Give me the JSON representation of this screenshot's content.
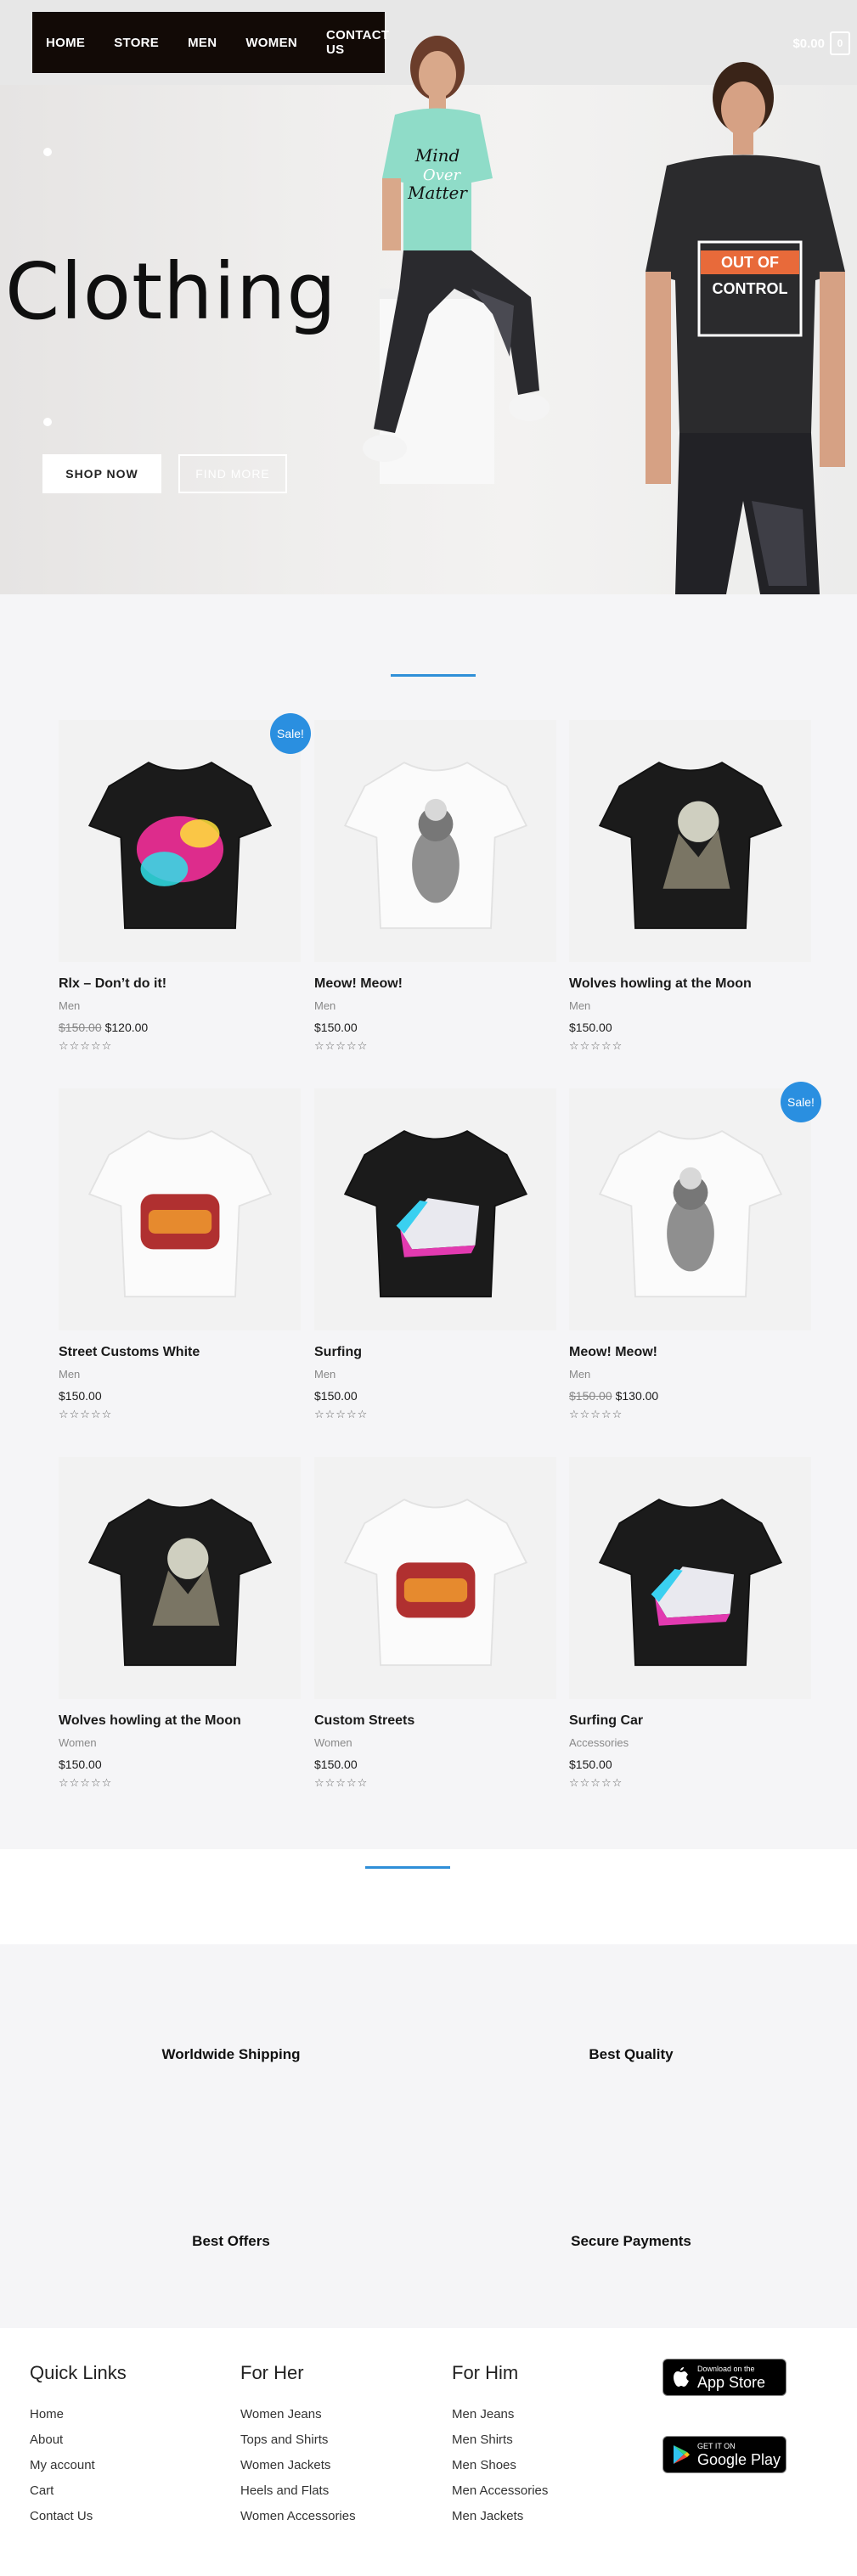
{
  "nav": {
    "items": [
      "HOME",
      "STORE",
      "MEN",
      "WOMEN",
      "CONTACT US"
    ],
    "cart_total": "$0.00",
    "cart_count": "0"
  },
  "hero": {
    "title": "Clothing",
    "shop_now": "SHOP NOW",
    "find_more": "FIND MORE",
    "shirt1_text": [
      "Mind",
      "Over",
      "Matter"
    ],
    "shirt2_text": [
      "OUT OF",
      "CONTROL"
    ]
  },
  "products": [
    {
      "name": "Rlx – Don’t do it!",
      "category": "Men",
      "old_price": "$150.00",
      "price": "$120.00",
      "sale": "Sale!",
      "shirt": "black",
      "art": "graffiti"
    },
    {
      "name": "Meow! Meow!",
      "category": "Men",
      "old_price": "",
      "price": "$150.00",
      "sale": "",
      "shirt": "white",
      "art": "cat"
    },
    {
      "name": "Wolves howling at the Moon",
      "category": "Men",
      "old_price": "",
      "price": "$150.00",
      "sale": "",
      "shirt": "black",
      "art": "wolves"
    },
    {
      "name": "Street Customs White",
      "category": "Men",
      "old_price": "",
      "price": "$150.00",
      "sale": "",
      "shirt": "white",
      "art": "street"
    },
    {
      "name": "Surfing",
      "category": "Men",
      "old_price": "",
      "price": "$150.00",
      "sale": "",
      "shirt": "black",
      "art": "car"
    },
    {
      "name": "Meow! Meow!",
      "category": "Men",
      "old_price": "$150.00",
      "price": "$130.00",
      "sale": "Sale!",
      "shirt": "white",
      "art": "cat"
    },
    {
      "name": "Wolves howling at the Moon",
      "category": "Women",
      "old_price": "",
      "price": "$150.00",
      "sale": "",
      "shirt": "black",
      "art": "wolves"
    },
    {
      "name": "Custom Streets",
      "category": "Women",
      "old_price": "",
      "price": "$150.00",
      "sale": "",
      "shirt": "white",
      "art": "street"
    },
    {
      "name": "Surfing Car",
      "category": "Accessories",
      "old_price": "",
      "price": "$150.00",
      "sale": "",
      "shirt": "black",
      "art": "car"
    }
  ],
  "rating_stars": "☆☆☆☆☆",
  "features": [
    "Worldwide Shipping",
    "Best Quality",
    "Best Offers",
    "Secure Payments"
  ],
  "footer": {
    "cols": [
      {
        "title": "Quick Links",
        "links": [
          "Home",
          "About",
          "My account",
          "Cart",
          "Contact Us"
        ]
      },
      {
        "title": "For Her",
        "links": [
          "Women Jeans",
          "Tops and Shirts",
          "Women Jackets",
          "Heels and Flats",
          "Women Accessories"
        ]
      },
      {
        "title": "For Him",
        "links": [
          "Men Jeans",
          "Men Shirts",
          "Men Shoes",
          "Men Accessories",
          "Men Jackets"
        ]
      }
    ],
    "app_store": {
      "small": "Download on the",
      "big": "App Store"
    },
    "google_play": {
      "small": "GET IT ON",
      "big": "Google Play"
    }
  },
  "colors": {
    "accent": "#2a8fe0",
    "nav_bg": "#120a06",
    "section_bg": "#f5f5f7"
  }
}
